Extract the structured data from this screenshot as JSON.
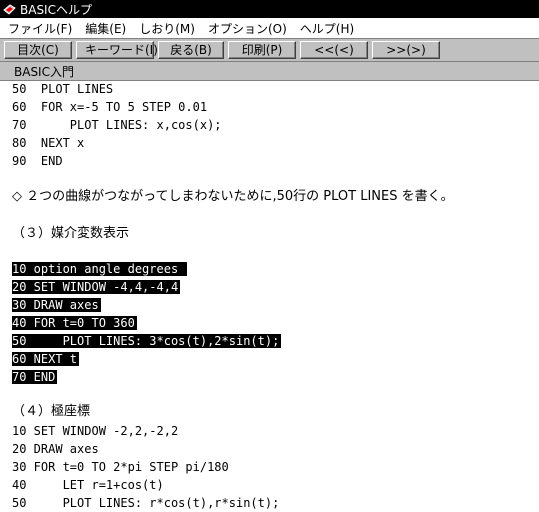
{
  "window": {
    "title": "BASICヘルプ"
  },
  "menu": [
    "ファイル(F)",
    "編集(E)",
    "しおり(M)",
    "オプション(O)",
    "ヘルプ(H)"
  ],
  "toolbar": [
    "目次(C)",
    "キーワード(I)",
    "戻る(B)",
    "印刷(P)",
    "<<(<)",
    ">>(>)"
  ],
  "topic": "BASIC入門",
  "content": {
    "block1": [
      "50  PLOT LINES",
      "60  FOR x=-5 TO 5 STEP 0.01",
      "70      PLOT LINES: x,cos(x);",
      "80  NEXT x",
      "90  END"
    ],
    "note": "◇ ２つの曲線がつながってしまわないために,50行の PLOT LINES を書く。",
    "heading3": "（３）媒介変数表示",
    "block2": [
      "10 option angle degrees ",
      "20 SET WINDOW -4,4,-4,4",
      "30 DRAW axes",
      "40 FOR t=0 TO 360",
      "50     PLOT LINES: 3*cos(t),2*sin(t);",
      "60 NEXT t",
      "70 END"
    ],
    "heading4": "（４）極座標",
    "block3": [
      "10 SET WINDOW -2,2,-2,2",
      "20 DRAW axes",
      "30 FOR t=0 TO 2*pi STEP pi/180",
      "40     LET r=1+cos(t)",
      "50     PLOT LINES: r*cos(t),r*sin(t);"
    ]
  }
}
